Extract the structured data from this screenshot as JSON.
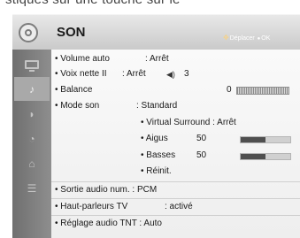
{
  "top_partial_text": "stiques sur une touche sur le",
  "header": {
    "title": "SON",
    "hint_move": "Déplacer",
    "hint_ok": "OK"
  },
  "menu": {
    "volume_auto": {
      "label": "• Volume auto",
      "value": ": Arrêt"
    },
    "voix_nette": {
      "label": "• Voix nette II",
      "value": ": Arrêt",
      "level": "3"
    },
    "balance": {
      "label": "• Balance",
      "value": "0"
    },
    "mode_son": {
      "label": "• Mode son",
      "value": ": Standard"
    },
    "virtual_surround": {
      "label": "• Virtual Surround : Arrêt"
    },
    "aigus": {
      "label": "• Aigus",
      "value": "50",
      "level": 0.5
    },
    "basses": {
      "label": "• Basses",
      "value": "50",
      "level": 0.5
    },
    "reinit": {
      "label": "• Réinit."
    },
    "sortie_audio": {
      "label": "• Sortie audio num. : PCM"
    },
    "haut_parleurs": {
      "label": "• Haut-parleurs TV",
      "value": ": activé"
    },
    "reglage_tnt": {
      "label": "• Réglage audio TNT : Auto"
    }
  },
  "sidebar_items": [
    "picture",
    "sound",
    "channel",
    "time",
    "lock",
    "option"
  ],
  "active_sidebar_item": "sound"
}
